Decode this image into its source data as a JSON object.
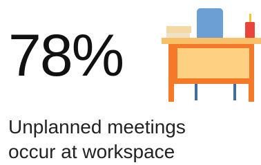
{
  "stat": {
    "value": "78%",
    "caption_line1": "Unplanned meetings",
    "caption_line2": "occur at workspace"
  },
  "illustration": {
    "icon": "desk-with-chair-icon",
    "colors": {
      "desk_frame": "#f47a2a",
      "desk_panel": "#fdd082",
      "desk_top": "#f9c06a",
      "chair": "#6c9fd4",
      "chair_legs": "#3d6e9e",
      "books": "#f4d9a4",
      "cup": "#e8443c",
      "pencil": "#f4c232"
    }
  }
}
